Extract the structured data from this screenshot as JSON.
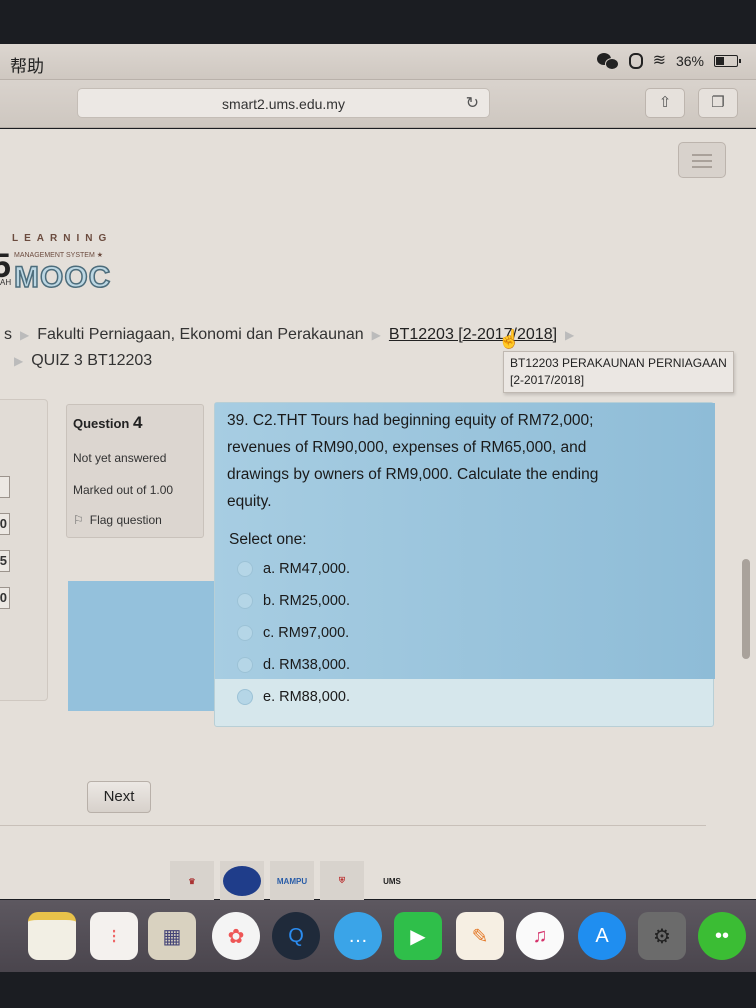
{
  "menubar": {
    "app_menu": "帮助",
    "battery_percent": "36%",
    "battery_level": 0.36
  },
  "browser": {
    "url": "smart2.ums.edu.my",
    "reload_icon": "↻",
    "share_icon": "⇧",
    "tabs_icon": "❐"
  },
  "logo": {
    "line1": "LEARNING",
    "line2": "MANAGEMENT SYSTEM ★",
    "name": "MOOC",
    "left_fragment": "AH",
    "left_glyph": "5"
  },
  "breadcrumb": {
    "leading": "s",
    "items": [
      "Fakulti Perniagaan, Ekonomi dan Perakaunan",
      "BT12203 [2-2017/2018]",
      "QUIZ 3 BT12203"
    ],
    "tooltip_line1": "BT12203 PERAKAUNAN PERNIAGAAN",
    "tooltip_line2": "[2-2017/2018]"
  },
  "quiz_nav": {
    "partial_values": [
      "",
      "0",
      "5",
      "0"
    ]
  },
  "question_info": {
    "label": "Question",
    "number": "4",
    "status": "Not yet answered",
    "marks": "Marked out of 1.00",
    "flag_label": "Flag question"
  },
  "question": {
    "text": "39. C2.THT Tours had beginning equity of RM72,000; revenues of RM90,000, expenses of RM65,000, and drawings by owners of RM9,000. Calculate the ending equity.",
    "prompt": "Select one:",
    "options": [
      {
        "letter": "a.",
        "value": "RM47,000."
      },
      {
        "letter": "b.",
        "value": "RM25,000."
      },
      {
        "letter": "c.",
        "value": "RM97,000."
      },
      {
        "letter": "d.",
        "value": "RM38,000."
      },
      {
        "letter": "e.",
        "value": "RM88,000."
      }
    ]
  },
  "actions": {
    "next_label": "Next"
  },
  "footer_logos": [
    "Jata Negara",
    "Logo",
    "MAMPU",
    "Sabah",
    "UMS Investment"
  ],
  "dock": [
    "Notes",
    "Reminders",
    "Preview",
    "Photos",
    "QuickTime",
    "Messages",
    "FaceTime",
    "Pages",
    "iTunes",
    "App Store",
    "System Preferences",
    "WeChat"
  ]
}
